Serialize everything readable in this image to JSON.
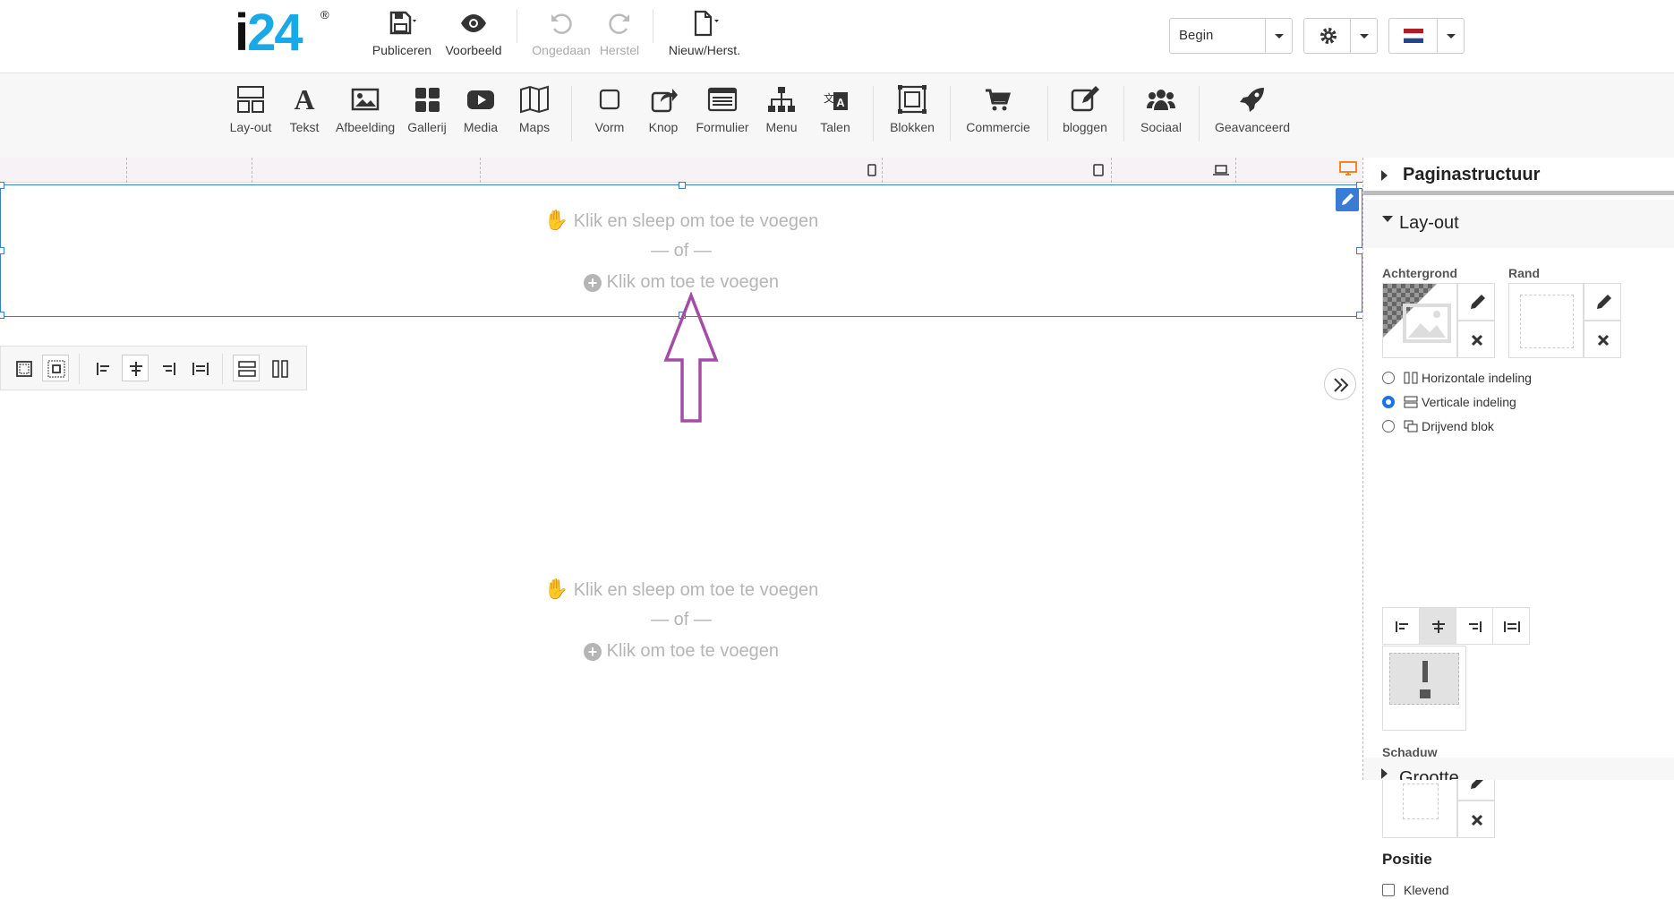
{
  "brand": {
    "logo_i": "i",
    "logo_rest": "24",
    "reg": "®"
  },
  "top_actions": {
    "publish": "Publiceren",
    "preview": "Voorbeeld",
    "undo": "Ongedaan",
    "redo": "Herstel",
    "new": "Nieuw/Herst."
  },
  "page_select": {
    "value": "Begin"
  },
  "tools": [
    "Lay-out",
    "Tekst",
    "Afbeelding",
    "Gallerij",
    "Media",
    "Maps",
    "Vorm",
    "Knop",
    "Formulier",
    "Menu",
    "Talen",
    "Blokken",
    "Commercie",
    "bloggen",
    "Sociaal",
    "Geavanceerd"
  ],
  "placeholder": {
    "drag": "Klik en sleep om toe te voegen",
    "or": "— of —",
    "click": "Klik om toe te voegen"
  },
  "panel": {
    "structure": "Paginastructuur",
    "layout": "Lay-out",
    "background": "Achtergrond",
    "border": "Rand",
    "options": [
      "Horizontale indeling",
      "Verticale indeling",
      "Drijvend blok"
    ],
    "selected_option": "Verticale indeling",
    "shadow": "Schaduw",
    "position": "Positie",
    "sticky": "Klevend",
    "next": "Grootte"
  },
  "colors": {
    "accent": "#1a73e8",
    "selection": "#3a7bd5",
    "brand": "#18a9e8",
    "annotation": "#a64ca6",
    "device_active": "#f07c10"
  }
}
